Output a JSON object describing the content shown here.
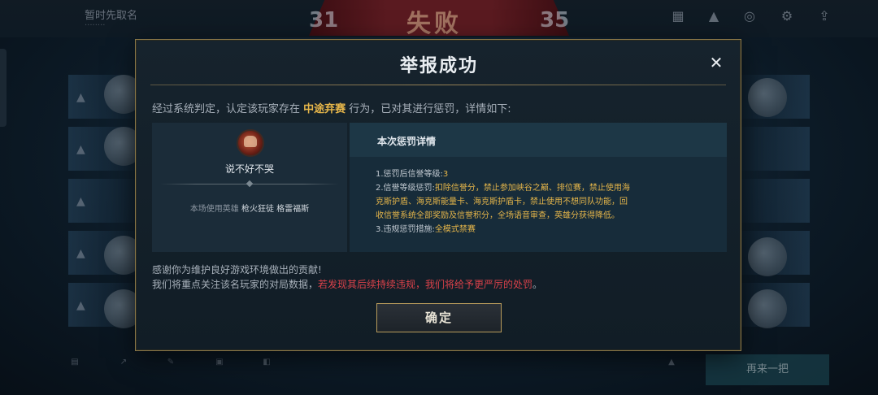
{
  "background": {
    "player_name": "暂时先取名",
    "player_sub": "········",
    "score_left": "31",
    "score_right": "35",
    "result": "失败",
    "next_button": "再来一把"
  },
  "modal": {
    "title": "举报成功",
    "close_icon": "✕",
    "intro_prefix": "经过系统判定，认定该玩家存在 ",
    "intro_highlight": "中途弃赛",
    "intro_suffix": " 行为，已对其进行惩罚，详情如下:",
    "reported_player": {
      "name": "说不好不哭",
      "hero_prefix": "本场使用英雄 ",
      "hero_name": "枪火狂徒 格雷福斯"
    },
    "penalty": {
      "title": "本次惩罚详情",
      "item1_label": "1.惩罚后信誉等级:",
      "item1_value": "3",
      "item2_label": "2.信誉等级惩罚:",
      "item2_value_line1": "扣除信誉分，禁止参加峡谷之巅、排位赛，禁止使用海",
      "item2_value_line2": "克斯护盾、海克斯能量卡、海克斯护盾卡，禁止使用不想同队功能，回",
      "item2_value_line3": "收信誉系统全部奖励及信誉积分，全场语音审查，英雄分获得降低。",
      "item3_label": "3.违规惩罚措施:",
      "item3_value": "全模式禁赛"
    },
    "thanks_line1": "感谢你为维护良好游戏环境做出的贡献!",
    "thanks_line2_prefix": "我们将重点关注该名玩家的对局数据，",
    "thanks_line2_red": "若发现其后续持续违规，我们将给予更严厉的处罚",
    "thanks_line2_suffix": "。",
    "confirm_label": "确定"
  },
  "colors": {
    "accent_gold": "#e6b64a",
    "warning_red": "#d9414a",
    "border_gold": "#8a7748"
  }
}
